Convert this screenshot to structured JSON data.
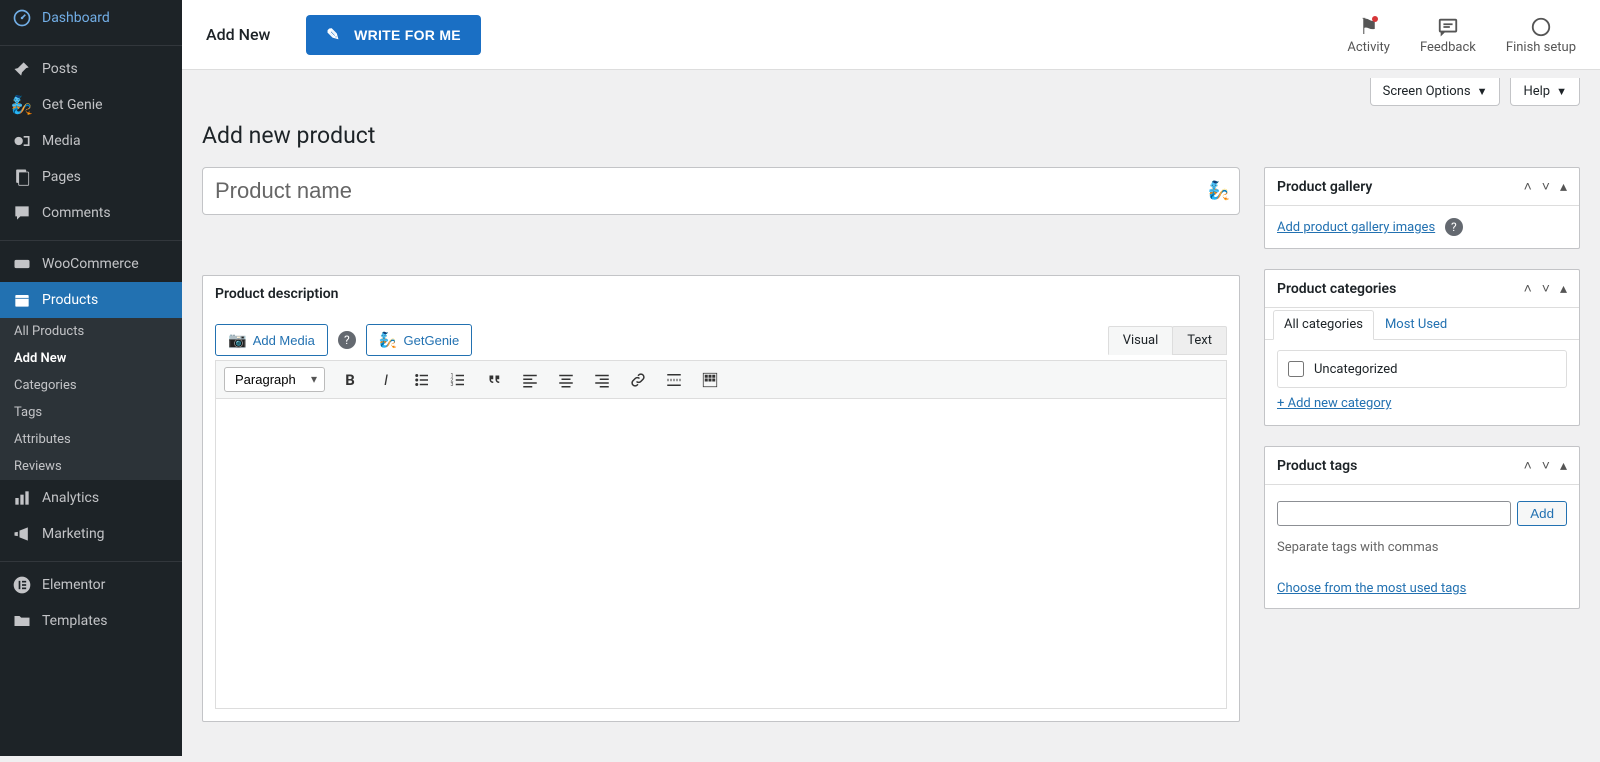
{
  "sidebar": {
    "items": [
      {
        "label": "Dashboard",
        "icon": "dash"
      },
      {
        "label": "Posts",
        "icon": "pin"
      },
      {
        "label": "Get Genie",
        "icon": "genie"
      },
      {
        "label": "Media",
        "icon": "media"
      },
      {
        "label": "Pages",
        "icon": "pages"
      },
      {
        "label": "Comments",
        "icon": "comment"
      },
      {
        "label": "WooCommerce",
        "icon": "woo"
      },
      {
        "label": "Products",
        "icon": "product",
        "active": true
      },
      {
        "label": "Analytics",
        "icon": "chart"
      },
      {
        "label": "Marketing",
        "icon": "horn"
      },
      {
        "label": "Elementor",
        "icon": "ele"
      },
      {
        "label": "Templates",
        "icon": "folder"
      }
    ],
    "subitems": [
      {
        "label": "All Products"
      },
      {
        "label": "Add New",
        "current": true
      },
      {
        "label": "Categories"
      },
      {
        "label": "Tags"
      },
      {
        "label": "Attributes"
      },
      {
        "label": "Reviews"
      }
    ]
  },
  "topbar": {
    "title": "Add New",
    "write_btn": "WRITE FOR ME",
    "activity": "Activity",
    "feedback": "Feedback",
    "finish": "Finish setup"
  },
  "screen_options": "Screen Options",
  "help": "Help",
  "page_title": "Add new product",
  "product_name_placeholder": "Product name",
  "editor": {
    "heading": "Product description",
    "add_media": "Add Media",
    "getgenie": "GetGenie",
    "tab_visual": "Visual",
    "tab_text": "Text",
    "paragraph": "Paragraph"
  },
  "panel_gallery": {
    "title": "Product gallery",
    "link": "Add product gallery images"
  },
  "panel_categories": {
    "title": "Product categories",
    "tab_all": "All categories",
    "tab_most": "Most Used",
    "uncategorized": "Uncategorized",
    "add_link": "+ Add new category"
  },
  "panel_tags": {
    "title": "Product tags",
    "add": "Add",
    "hint": "Separate tags with commas",
    "choose": "Choose from the most used tags"
  }
}
